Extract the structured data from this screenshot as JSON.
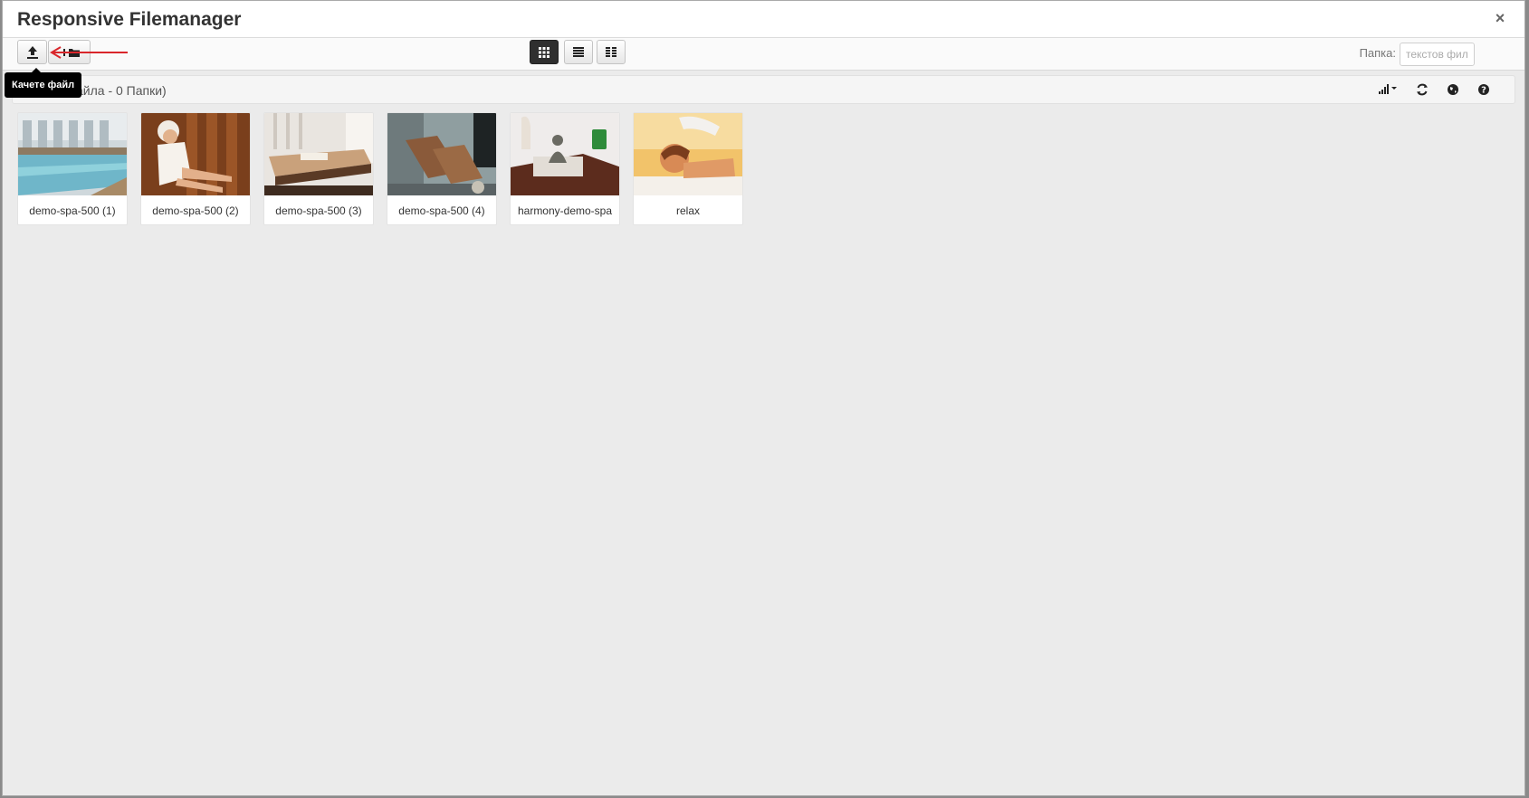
{
  "window": {
    "title": "Responsive Filemanager",
    "close_label": "×"
  },
  "toolbar": {
    "upload_tooltip": "Качете файл",
    "view_modes": [
      "grid-view",
      "list-view",
      "columns-view"
    ],
    "active_view": "grid-view",
    "folder_label": "Папка:",
    "search_placeholder": "текстов фил"
  },
  "breadcrumb": {
    "summary_text": "айла - 0 Папки)"
  },
  "files": [
    {
      "name": "demo-spa-500 (1)",
      "scene": "pool"
    },
    {
      "name": "demo-spa-500 (2)",
      "scene": "sauna"
    },
    {
      "name": "demo-spa-500 (3)",
      "scene": "massage-bed"
    },
    {
      "name": "demo-spa-500 (4)",
      "scene": "loungers"
    },
    {
      "name": "harmony-demo-spa",
      "scene": "buddha"
    },
    {
      "name": "relax",
      "scene": "massage"
    }
  ],
  "colors": {
    "accent_arrow": "#d9262b",
    "active_button": "#2f2f2f",
    "background": "#ebebeb"
  }
}
